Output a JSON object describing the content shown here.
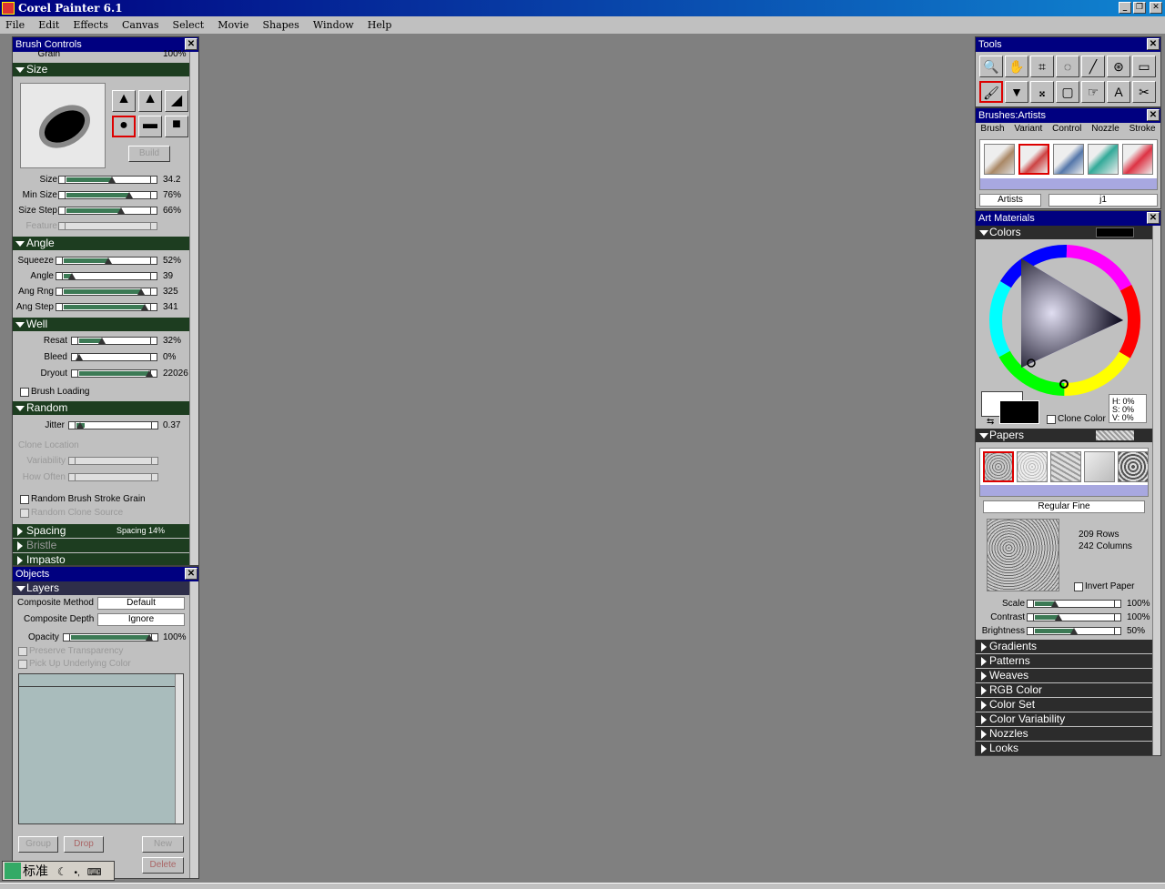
{
  "window": {
    "title": "Corel Painter 6.1",
    "min": "_",
    "restore": "❐",
    "close": "✕"
  },
  "menu": [
    "File",
    "Edit",
    "Effects",
    "Canvas",
    "Select",
    "Movie",
    "Shapes",
    "Window",
    "Help"
  ],
  "brush_controls": {
    "title": "Brush Controls",
    "grain": {
      "label": "Grain",
      "value": "100%"
    },
    "size_section": "Size",
    "build": "Build",
    "size_sliders": [
      {
        "label": "Size",
        "value": "34.2",
        "level": 0.55
      },
      {
        "label": "Min Size",
        "value": "76%",
        "level": 0.76
      },
      {
        "label": "Size Step",
        "value": "66%",
        "level": 0.66
      },
      {
        "label": "Feature",
        "value": "",
        "level": 0
      }
    ],
    "angle_section": "Angle",
    "angle_sliders": [
      {
        "label": "Squeeze",
        "value": "52%",
        "level": 0.52
      },
      {
        "label": "Angle",
        "value": "39",
        "level": 0.1
      },
      {
        "label": "Ang Rng",
        "value": "325",
        "level": 0.9
      },
      {
        "label": "Ang Step",
        "value": "341",
        "level": 0.95
      }
    ],
    "well_section": "Well",
    "well_sliders": [
      {
        "label": "Resat",
        "value": "32%",
        "level": 0.32
      },
      {
        "label": "Bleed",
        "value": "0%",
        "level": 0.0
      },
      {
        "label": "Dryout",
        "value": "22026",
        "level": 1.0
      }
    ],
    "brush_loading": "Brush Loading",
    "random_section": "Random",
    "jitter": {
      "label": "Jitter",
      "value": "0.37",
      "level": 0.1
    },
    "clone_location": "Clone Location",
    "variability": "Variability",
    "how_often": "How Often",
    "random_grain": "Random Brush Stroke Grain",
    "random_clone": "Random Clone Source",
    "spacing_section": "Spacing",
    "spacing_info": "Spacing 14%",
    "bristle_section": "Bristle",
    "impasto_section": "Impasto"
  },
  "objects": {
    "title": "Objects",
    "layers": "Layers",
    "composite_method_label": "Composite Method",
    "composite_method": "Default",
    "composite_depth_label": "Composite Depth",
    "composite_depth": "Ignore",
    "opacity_label": "Opacity",
    "opacity": "100%",
    "preserve": "Preserve Transparency",
    "pickup": "Pick Up Underlying Color",
    "group": "Group",
    "drop": "Drop",
    "new": "New",
    "delete": "Delete"
  },
  "tools": {
    "title": "Tools",
    "icons": [
      "🔍",
      "✋",
      "⌗",
      "◌",
      "╱",
      "⊛",
      "▭",
      "🖌",
      "▼",
      "𝄪",
      "▢",
      "☞",
      "A",
      "✂"
    ]
  },
  "brushes": {
    "title": "Brushes:Artists",
    "tabs": [
      "Brush",
      "Variant",
      "Control",
      "Nozzle",
      "Stroke"
    ],
    "category": "Artists",
    "variant": "j1"
  },
  "art_materials": {
    "title": "Art Materials",
    "colors": "Colors",
    "hsv": [
      "H: 0%",
      "S: 0%",
      "V: 0%"
    ],
    "clone_color": "Clone Color",
    "papers": "Papers",
    "paper_name": "Regular Fine",
    "rows": "209 Rows",
    "cols": "242 Columns",
    "invert": "Invert Paper",
    "paper_sliders": [
      {
        "label": "Scale",
        "value": "100%",
        "level": 0.25
      },
      {
        "label": "Contrast",
        "value": "100%",
        "level": 0.3
      },
      {
        "label": "Brightness",
        "value": "50%",
        "level": 0.5
      }
    ],
    "sections": [
      "Gradients",
      "Patterns",
      "Weaves",
      "RGB Color",
      "Color Set",
      "Color Variability",
      "Nozzles",
      "Looks"
    ]
  },
  "ime": {
    "label": "标准"
  }
}
